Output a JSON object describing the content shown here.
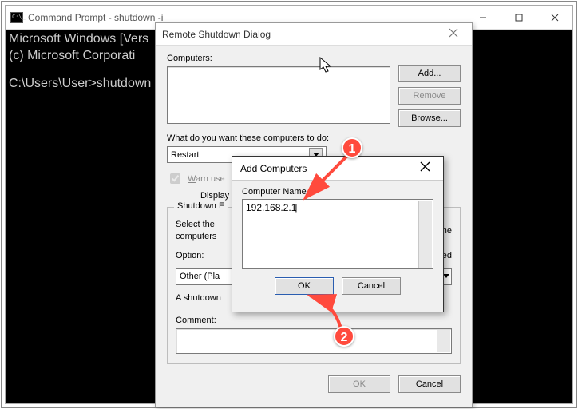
{
  "cmd": {
    "title": "Command Prompt - shutdown  -i",
    "line1": "Microsoft Windows [Vers",
    "line2": "(c) Microsoft Corporati",
    "prompt": "C:\\Users\\User>shutdown "
  },
  "rsd": {
    "title": "Remote Shutdown Dialog",
    "computers_label": "Computers:",
    "add_btn": "Add...",
    "remove_btn": "Remove",
    "browse_btn": "Browse...",
    "action_label": "What do you want these computers to do:",
    "action_value": "Restart",
    "warn_label": "Warn users of the action",
    "display_label": "Display w",
    "groupbox_title": "Shutdown E",
    "group_text_1": "Select the",
    "group_text_2": "computers",
    "group_text_right": "wn the",
    "option_label": "Option:",
    "option_value": "Other (Pla",
    "planned_label": "Planned",
    "ashutdown_label": "A shutdown",
    "comment_label": "Comment:",
    "ok_btn": "OK",
    "cancel_btn": "Cancel"
  },
  "ac": {
    "title": "Add Computers",
    "name_label": "Computer Name",
    "value": "192.168.2.1",
    "ok_btn": "OK",
    "cancel_btn": "Cancel"
  },
  "anno": {
    "badge1": "1",
    "badge2": "2"
  }
}
